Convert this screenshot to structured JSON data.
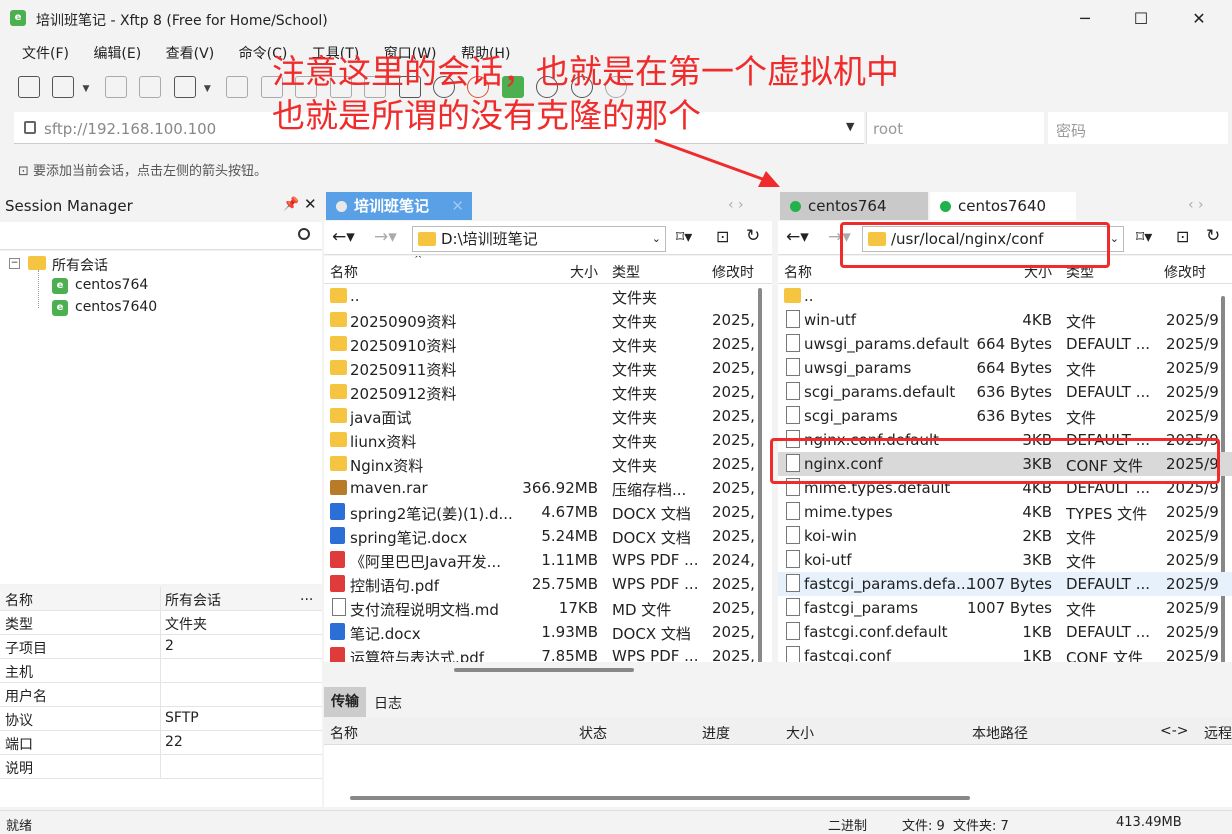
{
  "window": {
    "title": "培训班笔记 - Xftp 8 (Free for Home/School)",
    "minimize": "─",
    "maximize": "☐",
    "close": "✕"
  },
  "menu": [
    "文件(F)",
    "编辑(E)",
    "查看(V)",
    "命令(C)",
    "工具(T)",
    "窗口(W)",
    "帮助(H)"
  ],
  "address": {
    "value": "sftp://192.168.100.100",
    "user_placeholder": "root",
    "pass_placeholder": "密码"
  },
  "hint": "要添加当前会话，点击左侧的箭头按钮。",
  "annotation": {
    "line1": "注意这里的会话，也就是在第一个虚拟机中",
    "line2": "也就是所谓的没有克隆的那个"
  },
  "session_manager": {
    "title": "Session Manager",
    "root": "所有会话",
    "sessions": [
      "centos764",
      "centos7640"
    ]
  },
  "properties": {
    "header": {
      "k": "名称",
      "v": "所有会话",
      "more": "..."
    },
    "rows": [
      {
        "k": "类型",
        "v": "文件夹"
      },
      {
        "k": "子项目",
        "v": "2"
      },
      {
        "k": "主机",
        "v": ""
      },
      {
        "k": "用户名",
        "v": ""
      },
      {
        "k": "协议",
        "v": "SFTP"
      },
      {
        "k": "端口",
        "v": "22"
      },
      {
        "k": "说明",
        "v": ""
      }
    ]
  },
  "local": {
    "tab": "培训班笔记",
    "path": "D:\\培训班笔记",
    "columns": [
      "名称",
      "大小",
      "类型",
      "修改时"
    ],
    "files": [
      {
        "name": "..",
        "size": "",
        "type": "文件夹",
        "date": "",
        "icon": "folder"
      },
      {
        "name": "20250909资料",
        "size": "",
        "type": "文件夹",
        "date": "2025,",
        "icon": "folder"
      },
      {
        "name": "20250910资料",
        "size": "",
        "type": "文件夹",
        "date": "2025,",
        "icon": "folder"
      },
      {
        "name": "20250911资料",
        "size": "",
        "type": "文件夹",
        "date": "2025,",
        "icon": "folder"
      },
      {
        "name": "20250912资料",
        "size": "",
        "type": "文件夹",
        "date": "2025,",
        "icon": "folder"
      },
      {
        "name": "java面试",
        "size": "",
        "type": "文件夹",
        "date": "2025,",
        "icon": "folder"
      },
      {
        "name": "liunx资料",
        "size": "",
        "type": "文件夹",
        "date": "2025,",
        "icon": "folder"
      },
      {
        "name": "Nginx资料",
        "size": "",
        "type": "文件夹",
        "date": "2025,",
        "icon": "folder"
      },
      {
        "name": "maven.rar",
        "size": "366.92MB",
        "type": "压缩存档...",
        "date": "2025,",
        "icon": "rar"
      },
      {
        "name": "spring2笔记(姜)(1).d...",
        "size": "4.67MB",
        "type": "DOCX 文档",
        "date": "2025,",
        "icon": "word"
      },
      {
        "name": "spring笔记.docx",
        "size": "5.24MB",
        "type": "DOCX 文档",
        "date": "2025,",
        "icon": "word"
      },
      {
        "name": "《阿里巴巴Java开发...",
        "size": "1.11MB",
        "type": "WPS PDF ...",
        "date": "2024,",
        "icon": "pdf"
      },
      {
        "name": "控制语句.pdf",
        "size": "25.75MB",
        "type": "WPS PDF ...",
        "date": "2025,",
        "icon": "pdf"
      },
      {
        "name": "支付流程说明文档.md",
        "size": "17KB",
        "type": "MD 文件",
        "date": "2025,",
        "icon": "doc"
      },
      {
        "name": "笔记.docx",
        "size": "1.93MB",
        "type": "DOCX 文档",
        "date": "2025,",
        "icon": "word"
      },
      {
        "name": "运算符与表达式.pdf",
        "size": "7.85MB",
        "type": "WPS PDF ...",
        "date": "2025,",
        "icon": "pdf"
      }
    ]
  },
  "remote": {
    "tabs": [
      "centos764",
      "centos7640"
    ],
    "path": "/usr/local/nginx/conf",
    "columns": [
      "名称",
      "大小",
      "类型",
      "修改时"
    ],
    "files": [
      {
        "name": "..",
        "size": "",
        "type": "",
        "date": "",
        "icon": "folder"
      },
      {
        "name": "win-utf",
        "size": "4KB",
        "type": "文件",
        "date": "2025/9",
        "icon": "doc"
      },
      {
        "name": "uwsgi_params.default",
        "size": "664 Bytes",
        "type": "DEFAULT ...",
        "date": "2025/9",
        "icon": "doc"
      },
      {
        "name": "uwsgi_params",
        "size": "664 Bytes",
        "type": "文件",
        "date": "2025/9",
        "icon": "doc"
      },
      {
        "name": "scgi_params.default",
        "size": "636 Bytes",
        "type": "DEFAULT ...",
        "date": "2025/9",
        "icon": "doc"
      },
      {
        "name": "scgi_params",
        "size": "636 Bytes",
        "type": "文件",
        "date": "2025/9",
        "icon": "doc"
      },
      {
        "name": "nginx.conf.default",
        "size": "3KB",
        "type": "DEFAULT ...",
        "date": "2025/9",
        "icon": "doc"
      },
      {
        "name": "nginx.conf",
        "size": "3KB",
        "type": "CONF 文件",
        "date": "2025/9",
        "icon": "doc"
      },
      {
        "name": "mime.types.default",
        "size": "4KB",
        "type": "DEFAULT ...",
        "date": "2025/9",
        "icon": "doc"
      },
      {
        "name": "mime.types",
        "size": "4KB",
        "type": "TYPES 文件",
        "date": "2025/9",
        "icon": "doc"
      },
      {
        "name": "koi-win",
        "size": "2KB",
        "type": "文件",
        "date": "2025/9",
        "icon": "doc"
      },
      {
        "name": "koi-utf",
        "size": "3KB",
        "type": "文件",
        "date": "2025/9",
        "icon": "doc"
      },
      {
        "name": "fastcgi_params.defa...",
        "size": "1007 Bytes",
        "type": "DEFAULT ...",
        "date": "2025/9",
        "icon": "doc"
      },
      {
        "name": "fastcgi_params",
        "size": "1007 Bytes",
        "type": "文件",
        "date": "2025/9",
        "icon": "doc"
      },
      {
        "name": "fastcgi.conf.default",
        "size": "1KB",
        "type": "DEFAULT ...",
        "date": "2025/9",
        "icon": "doc"
      },
      {
        "name": "fastcgi.conf",
        "size": "1KB",
        "type": "CONF 文件",
        "date": "2025/9",
        "icon": "doc"
      }
    ]
  },
  "transfer": {
    "tabs": [
      "传输",
      "日志"
    ],
    "columns": [
      "名称",
      "状态",
      "进度",
      "大小",
      "本地路径",
      "<->",
      "远程"
    ]
  },
  "status": {
    "left": "就绪",
    "mode": "二进制",
    "counts": "文件: 9  文件夹: 7",
    "size": "413.49MB"
  }
}
